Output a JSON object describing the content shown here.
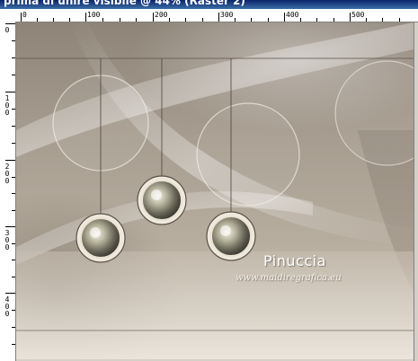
{
  "window": {
    "title": "prima di unire visibile @ 44% (Raster 2)"
  },
  "rulers": {
    "top_labels": [
      "0",
      "100",
      "200",
      "300",
      "400",
      "500"
    ],
    "left_labels": [
      "0",
      "100",
      "200",
      "300",
      "400"
    ]
  },
  "watermark": {
    "name": "Pinuccia",
    "url": "www.maidiregrafica.eu"
  },
  "colors": {
    "titlebar": "#0a246a",
    "canvas_base": "#a79d90"
  }
}
